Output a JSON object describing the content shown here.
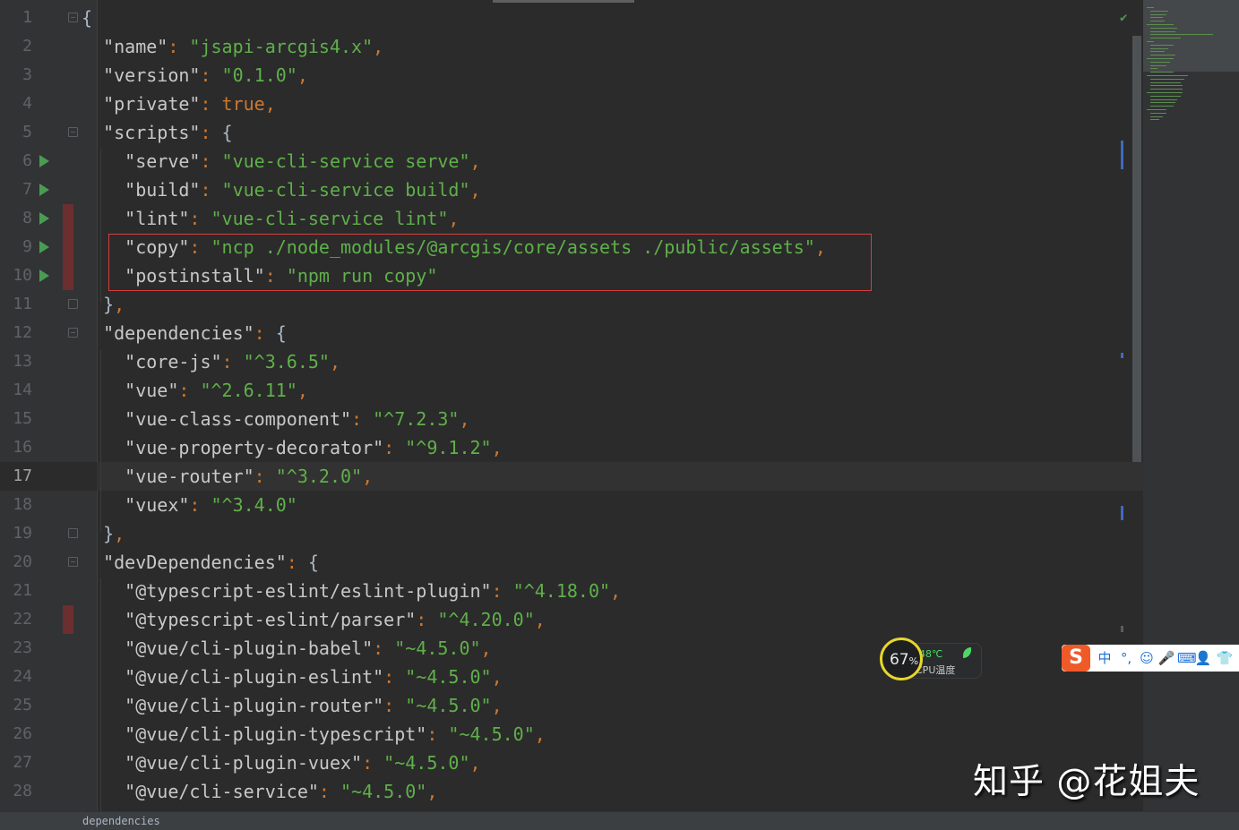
{
  "editor": {
    "lines": [
      {
        "n": "1",
        "tokens": [
          [
            "br",
            "{"
          ]
        ]
      },
      {
        "n": "2",
        "tokens": [
          [
            "k",
            "  \"name\""
          ],
          [
            "p",
            ": "
          ],
          [
            "s",
            "\"jsapi-arcgis4.x\""
          ],
          [
            "p",
            ","
          ]
        ]
      },
      {
        "n": "3",
        "tokens": [
          [
            "k",
            "  \"version\""
          ],
          [
            "p",
            ": "
          ],
          [
            "s",
            "\"0.1.0\""
          ],
          [
            "p",
            ","
          ]
        ]
      },
      {
        "n": "4",
        "tokens": [
          [
            "k",
            "  \"private\""
          ],
          [
            "p",
            ": "
          ],
          [
            "b",
            "true"
          ],
          [
            "p",
            ","
          ]
        ]
      },
      {
        "n": "5",
        "tokens": [
          [
            "k",
            "  \"scripts\""
          ],
          [
            "p",
            ": "
          ],
          [
            "br",
            "{"
          ]
        ]
      },
      {
        "n": "6",
        "tokens": [
          [
            "k",
            "    \"serve\""
          ],
          [
            "p",
            ": "
          ],
          [
            "s",
            "\"vue-cli-service serve\""
          ],
          [
            "p",
            ","
          ]
        ]
      },
      {
        "n": "7",
        "tokens": [
          [
            "k",
            "    \"build\""
          ],
          [
            "p",
            ": "
          ],
          [
            "s",
            "\"vue-cli-service build\""
          ],
          [
            "p",
            ","
          ]
        ]
      },
      {
        "n": "8",
        "tokens": [
          [
            "k",
            "    \"lint\""
          ],
          [
            "p",
            ": "
          ],
          [
            "s",
            "\"vue-cli-service lint\""
          ],
          [
            "p",
            ","
          ]
        ]
      },
      {
        "n": "9",
        "tokens": [
          [
            "k",
            "    \"copy\""
          ],
          [
            "p",
            ": "
          ],
          [
            "s",
            "\"ncp ./node_modules/@arcgis/core/assets ./public/assets\""
          ],
          [
            "p",
            ","
          ]
        ]
      },
      {
        "n": "10",
        "tokens": [
          [
            "k",
            "    \"postinstall\""
          ],
          [
            "p",
            ": "
          ],
          [
            "s",
            "\"npm run copy\""
          ]
        ]
      },
      {
        "n": "11",
        "tokens": [
          [
            "br",
            "  }"
          ],
          [
            "p",
            ","
          ]
        ]
      },
      {
        "n": "12",
        "tokens": [
          [
            "k",
            "  \"dependencies\""
          ],
          [
            "p",
            ": "
          ],
          [
            "br",
            "{"
          ]
        ]
      },
      {
        "n": "13",
        "tokens": [
          [
            "k",
            "    \"core-js\""
          ],
          [
            "p",
            ": "
          ],
          [
            "s",
            "\"^3.6.5\""
          ],
          [
            "p",
            ","
          ]
        ]
      },
      {
        "n": "14",
        "tokens": [
          [
            "k",
            "    \"vue\""
          ],
          [
            "p",
            ": "
          ],
          [
            "s",
            "\"^2.6.11\""
          ],
          [
            "p",
            ","
          ]
        ]
      },
      {
        "n": "15",
        "tokens": [
          [
            "k",
            "    \"vue-class-component\""
          ],
          [
            "p",
            ": "
          ],
          [
            "s",
            "\"^7.2.3\""
          ],
          [
            "p",
            ","
          ]
        ]
      },
      {
        "n": "16",
        "tokens": [
          [
            "k",
            "    \"vue-property-decorator\""
          ],
          [
            "p",
            ": "
          ],
          [
            "s",
            "\"^9.1.2\""
          ],
          [
            "p",
            ","
          ]
        ]
      },
      {
        "n": "17",
        "tokens": [
          [
            "k",
            "    \"vue-router\""
          ],
          [
            "p",
            ": "
          ],
          [
            "s",
            "\"^3.2.0\""
          ],
          [
            "p",
            ","
          ]
        ]
      },
      {
        "n": "18",
        "tokens": [
          [
            "k",
            "    \"vuex\""
          ],
          [
            "p",
            ": "
          ],
          [
            "s",
            "\"^3.4.0\""
          ]
        ]
      },
      {
        "n": "19",
        "tokens": [
          [
            "br",
            "  }"
          ],
          [
            "p",
            ","
          ]
        ]
      },
      {
        "n": "20",
        "tokens": [
          [
            "k",
            "  \"devDependencies\""
          ],
          [
            "p",
            ": "
          ],
          [
            "br",
            "{"
          ]
        ]
      },
      {
        "n": "21",
        "tokens": [
          [
            "k",
            "    \"@typescript-eslint/eslint-plugin\""
          ],
          [
            "p",
            ": "
          ],
          [
            "s",
            "\"^4.18.0\""
          ],
          [
            "p",
            ","
          ]
        ]
      },
      {
        "n": "22",
        "tokens": [
          [
            "k",
            "    \"@typescript-eslint/parser\""
          ],
          [
            "p",
            ": "
          ],
          [
            "s",
            "\"^4.20.0\""
          ],
          [
            "p",
            ","
          ]
        ]
      },
      {
        "n": "23",
        "tokens": [
          [
            "k",
            "    \"@vue/cli-plugin-babel\""
          ],
          [
            "p",
            ": "
          ],
          [
            "s",
            "\"~4.5.0\""
          ],
          [
            "p",
            ","
          ]
        ]
      },
      {
        "n": "24",
        "tokens": [
          [
            "k",
            "    \"@vue/cli-plugin-eslint\""
          ],
          [
            "p",
            ": "
          ],
          [
            "s",
            "\"~4.5.0\""
          ],
          [
            "p",
            ","
          ]
        ]
      },
      {
        "n": "25",
        "tokens": [
          [
            "k",
            "    \"@vue/cli-plugin-router\""
          ],
          [
            "p",
            ": "
          ],
          [
            "s",
            "\"~4.5.0\""
          ],
          [
            "p",
            ","
          ]
        ]
      },
      {
        "n": "26",
        "tokens": [
          [
            "k",
            "    \"@vue/cli-plugin-typescript\""
          ],
          [
            "p",
            ": "
          ],
          [
            "s",
            "\"~4.5.0\""
          ],
          [
            "p",
            ","
          ]
        ]
      },
      {
        "n": "27",
        "tokens": [
          [
            "k",
            "    \"@vue/cli-plugin-vuex\""
          ],
          [
            "p",
            ": "
          ],
          [
            "s",
            "\"~4.5.0\""
          ],
          [
            "p",
            ","
          ]
        ]
      },
      {
        "n": "28",
        "tokens": [
          [
            "k",
            "    \"@vue/cli-service\""
          ],
          [
            "p",
            ": "
          ],
          [
            "s",
            "\"~4.5.0\""
          ],
          [
            "p",
            ","
          ]
        ]
      }
    ],
    "current_line": "17",
    "run_icon_lines": [
      "6",
      "7",
      "8",
      "9",
      "10"
    ],
    "changed_lines": [
      "8",
      "9",
      "10",
      "22"
    ],
    "fold_open_lines": [
      "1",
      "5",
      "12",
      "20"
    ],
    "fold_close_lines": [
      "11",
      "19"
    ]
  },
  "status_bar": {
    "breadcrumb": "dependencies"
  },
  "cpu_widget": {
    "percent": "67",
    "percent_sign": "%",
    "temperature": "48℃",
    "label": "CPU温度"
  },
  "ime_toolbar": {
    "logo": "S",
    "items": [
      {
        "name": "ime-chinese-mode",
        "glyph": "中"
      },
      {
        "name": "ime-punctuation",
        "glyph": "°,"
      },
      {
        "name": "emoji-icon",
        "glyph": "☺"
      },
      {
        "name": "microphone-icon",
        "glyph": "🎤"
      },
      {
        "name": "keyboard-icon",
        "glyph": "⌨"
      },
      {
        "name": "user-icon",
        "glyph": "👤"
      },
      {
        "name": "skin-icon",
        "glyph": "👕"
      }
    ]
  },
  "watermark": "知乎 @花姐夫",
  "colors": {
    "accent_green": "#499c54",
    "highlight_red": "#d2403c",
    "change_mark": "#6b2f2f"
  }
}
